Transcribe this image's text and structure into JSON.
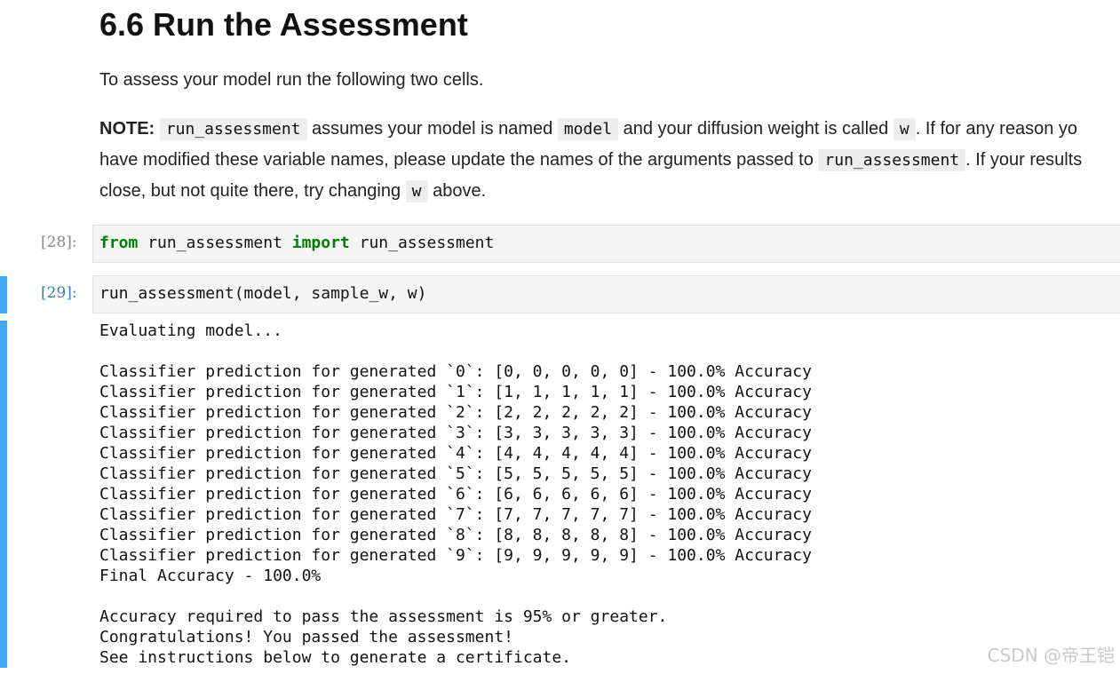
{
  "markdown": {
    "heading": "6.6 Run the Assessment",
    "intro": "To assess your model run the following two cells.",
    "note": {
      "label": "NOTE:",
      "code_run_assessment": "run_assessment",
      "t1": " assumes your model is named ",
      "code_model": "model",
      "t2": " and your diffusion weight is called ",
      "code_w": "w",
      "t3": ". If for any reason yo",
      "line2_a": "have modified these variable names, please update the names of the arguments passed to ",
      "code_run_assessment_2": "run_assessment",
      "line2_b": ". If your results",
      "line3_a": "close, but not quite there, try changing ",
      "code_w_2": "w",
      "line3_b": " above."
    }
  },
  "cells": [
    {
      "prompt": "[28]:",
      "code": {
        "kw_from": "from",
        "module": " run_assessment ",
        "kw_import": "import",
        "name": " run_assessment"
      }
    },
    {
      "prompt": "[29]:",
      "code_text": "run_assessment(model, sample_w, w)",
      "output_lines": [
        "Evaluating model...",
        "",
        "Classifier prediction for generated `0`: [0, 0, 0, 0, 0] - 100.0% Accuracy",
        "Classifier prediction for generated `1`: [1, 1, 1, 1, 1] - 100.0% Accuracy",
        "Classifier prediction for generated `2`: [2, 2, 2, 2, 2] - 100.0% Accuracy",
        "Classifier prediction for generated `3`: [3, 3, 3, 3, 3] - 100.0% Accuracy",
        "Classifier prediction for generated `4`: [4, 4, 4, 4, 4] - 100.0% Accuracy",
        "Classifier prediction for generated `5`: [5, 5, 5, 5, 5] - 100.0% Accuracy",
        "Classifier prediction for generated `6`: [6, 6, 6, 6, 6] - 100.0% Accuracy",
        "Classifier prediction for generated `7`: [7, 7, 7, 7, 7] - 100.0% Accuracy",
        "Classifier prediction for generated `8`: [8, 8, 8, 8, 8] - 100.0% Accuracy",
        "Classifier prediction for generated `9`: [9, 9, 9, 9, 9] - 100.0% Accuracy",
        "Final Accuracy - 100.0%",
        "",
        "Accuracy required to pass the assessment is 95% or greater.",
        "Congratulations! You passed the assessment!",
        "See instructions below to generate a certificate."
      ]
    }
  ],
  "watermark": "CSDN @帝王铠",
  "colors": {
    "active_cell_bar": "#42a5f5",
    "keyword": "#008000",
    "prompt_active": "#307fc1",
    "prompt_inactive": "#888888"
  }
}
